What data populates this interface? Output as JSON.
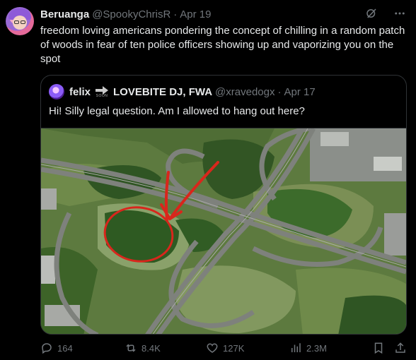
{
  "tweet": {
    "author_name": "Beruanga",
    "author_handle": "@SpookyChrisR",
    "separator": "·",
    "date": "Apr 19",
    "text": "freedom loving americans pondering the concept of chilling in a random patch of woods in fear of ten police officers showing up and vaporizing you on the spot",
    "more_icon": "more-dots-icon",
    "grok_icon": "grok-icon"
  },
  "quote": {
    "author_name": "felix",
    "badge_text": "SOON",
    "author_name_2": "LOVEBITE DJ, FWA",
    "author_handle": "@xravedogx",
    "separator": "·",
    "date": "Apr 17",
    "text": "Hi! Silly legal question. Am I allowed to hang out here?",
    "image_subject": "aerial photo of a highway cloverleaf interchange with a red hand-drawn arrow and circle around a patch of woods"
  },
  "actions": {
    "replies": "164",
    "reposts": "8.4K",
    "likes": "127K",
    "views": "2.3M"
  },
  "colors": {
    "background": "#000000",
    "text": "#e7e9ea",
    "muted": "#71767b",
    "border": "#2f3336",
    "annotation_red": "#d9261c"
  }
}
